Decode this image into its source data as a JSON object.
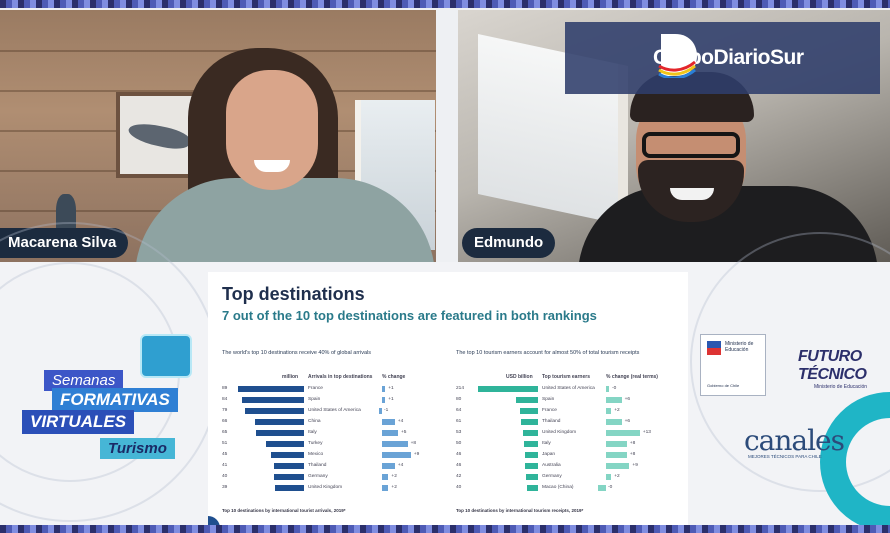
{
  "participants": {
    "left_name": "Macarena Silva",
    "right_name": "Edmundo"
  },
  "brand": {
    "logo_text": "GrupoDiarioSur"
  },
  "campaign": {
    "line1": "Semanas",
    "line2": "FORMATIVAS",
    "line3": "VIRTUALES",
    "line4": "Turismo"
  },
  "slide": {
    "title": "Top destinations",
    "subtitle": "7 out of the 10 top destinations are featured in both rankings",
    "left_panel": {
      "heading": "The world's top 10 destinations receive 40% of global arrivals",
      "col_value": "million",
      "col_name": "Arrivals in top destinations",
      "col_change": "% change",
      "footer": "Top 10 destinations by international tourist arrivals, 2019*",
      "rows": [
        {
          "value": "89",
          "name": "France",
          "change": "+1",
          "v": 89,
          "c": 1
        },
        {
          "value": "84",
          "name": "Spain",
          "change": "+1",
          "v": 84,
          "c": 1
        },
        {
          "value": "79",
          "name": "United States of America",
          "change": "-1",
          "v": 79,
          "c": -1
        },
        {
          "value": "66",
          "name": "China",
          "change": "+4",
          "v": 66,
          "c": 4
        },
        {
          "value": "65",
          "name": "Italy",
          "change": "+5",
          "v": 65,
          "c": 5
        },
        {
          "value": "51",
          "name": "Turkey",
          "change": "+8",
          "v": 51,
          "c": 8
        },
        {
          "value": "45",
          "name": "Mexico",
          "change": "+9",
          "v": 45,
          "c": 9
        },
        {
          "value": "41",
          "name": "Thailand",
          "change": "+4",
          "v": 41,
          "c": 4
        },
        {
          "value": "40",
          "name": "Germany",
          "change": "+2",
          "v": 40,
          "c": 2
        },
        {
          "value": "39",
          "name": "United Kingdom",
          "change": "+2",
          "v": 39,
          "c": 2
        }
      ]
    },
    "right_panel": {
      "heading": "The top 10 tourism earners account for almost 50% of total tourism receipts",
      "col_value": "USD billion",
      "col_name": "Top tourism earners",
      "col_change": "% change (real terms)",
      "footer": "Top 10 destinations by international tourism receipts, 2019*",
      "rows": [
        {
          "value": "214",
          "name": "United States of America",
          "change": "-0",
          "v": 214,
          "c": 0
        },
        {
          "value": "80",
          "name": "Spain",
          "change": "+6",
          "v": 80,
          "c": 6
        },
        {
          "value": "64",
          "name": "France",
          "change": "+2",
          "v": 64,
          "c": 2
        },
        {
          "value": "61",
          "name": "Thailand",
          "change": "+6",
          "v": 61,
          "c": 6
        },
        {
          "value": "53",
          "name": "United Kingdom",
          "change": "+13",
          "v": 53,
          "c": 13
        },
        {
          "value": "50",
          "name": "Italy",
          "change": "+8",
          "v": 50,
          "c": 8
        },
        {
          "value": "46",
          "name": "Japan",
          "change": "+8",
          "v": 46,
          "c": 8
        },
        {
          "value": "46",
          "name": "Australia",
          "change": "+9",
          "v": 46,
          "c": 9
        },
        {
          "value": "42",
          "name": "Germany",
          "change": "+2",
          "v": 42,
          "c": 2
        },
        {
          "value": "40",
          "name": "Macao (China)",
          "change": "-0",
          "v": 40,
          "c": -3
        }
      ]
    }
  },
  "sponsors": {
    "ministry_line": "Ministerio de Educación",
    "ministry_foot": "Gobierno de Chile",
    "futuro_title": "FUTURO TÉCNICO",
    "futuro_sub": "Ministerio de Educación",
    "canales_title": "canales",
    "canales_sub": "MEJORES TÉCNICOS PARA CHILE"
  },
  "colors": {
    "arrivals_bar": "#1f4f8f",
    "receipts_bar": "#2fb49a",
    "accent_teal": "#1fb5c6",
    "name_tag_bg": "#1c2b3f"
  },
  "icons": [
    "whale-painting-icon",
    "logo-d-icon",
    "campaign-avatar-icon",
    "chile-flag-icon"
  ]
}
